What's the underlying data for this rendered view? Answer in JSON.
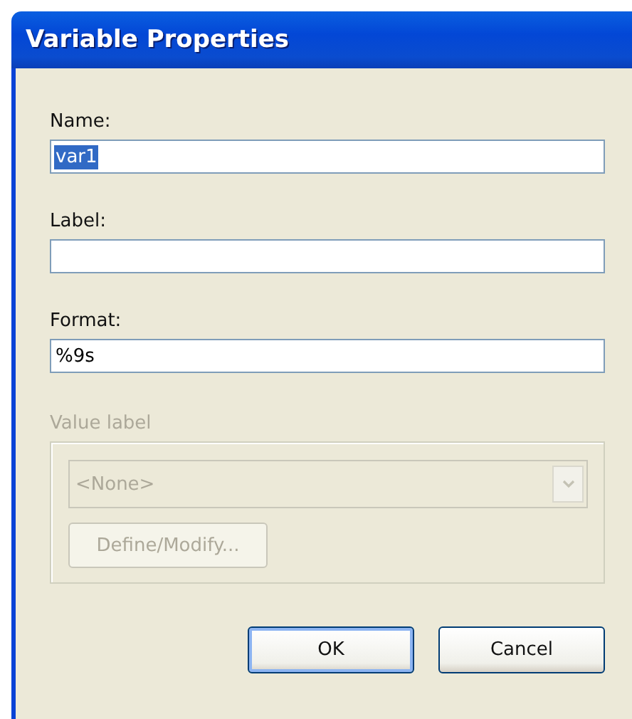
{
  "window": {
    "title": "Variable Properties"
  },
  "fields": [
    {
      "label": "Name:",
      "value": "var1",
      "text_selected": true
    },
    {
      "label": "Label:"
    },
    {
      "label": "Format:",
      "value": "%9s",
      "text_selected": false
    }
  ],
  "value_label": {
    "title": "Value label",
    "disabled": true,
    "combo_value": "<None>",
    "button": "Define/Modify..."
  },
  "buttons": [
    {
      "label": "OK",
      "default": true
    },
    {
      "label": "Cancel",
      "default": false
    }
  ]
}
